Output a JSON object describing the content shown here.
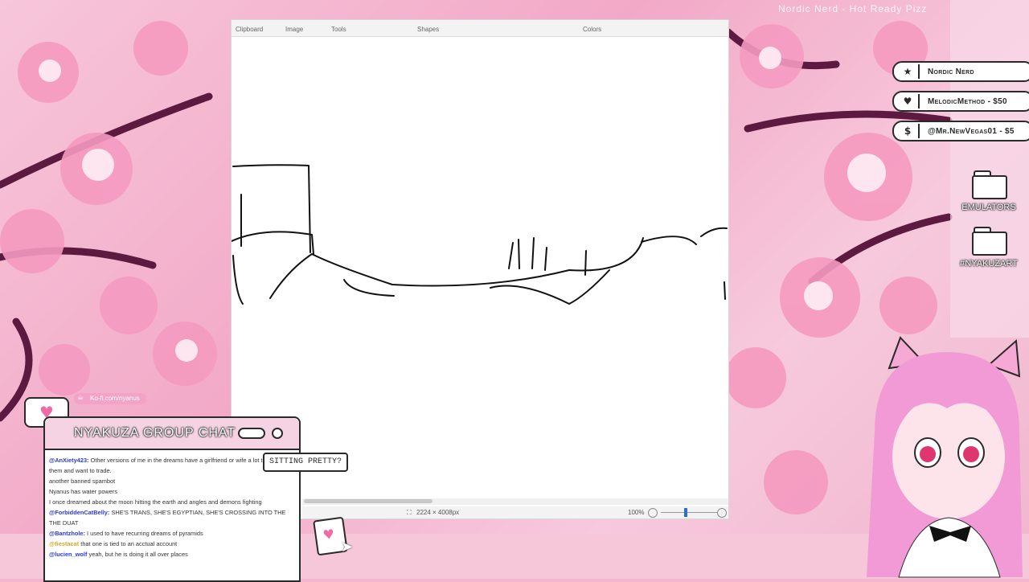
{
  "paint": {
    "ribbon": {
      "clipboard": "Clipboard",
      "image": "Image",
      "tools": "Tools",
      "shapes": "Shapes",
      "colors": "Colors"
    },
    "status": {
      "dimensions": "2224 × 4008px",
      "zoom": "100%"
    }
  },
  "now_playing": "Nordic Nerd - Hot Ready Pizz",
  "alerts": [
    {
      "icon": "star-icon",
      "glyph": "★",
      "text": "Nordic Nerd"
    },
    {
      "icon": "heart-icon",
      "glyph": "♥",
      "text": "MelodicMethod - $50"
    },
    {
      "icon": "dollar-icon",
      "glyph": "$",
      "text": "@Mr.NewVegas01 - $5"
    }
  ],
  "folders": [
    {
      "label": "EMULATORS"
    },
    {
      "label": "#NYAKUZART"
    }
  ],
  "kofi": "Ko-fi.com/nyanus",
  "chat": {
    "title": "NYAKUZA GROUP CHAT",
    "messages": [
      {
        "user": "@AnXiety423:",
        "user_color": "#2b3bd6",
        "text": "Other versions of me in the dreams have a girlfriend or wife a lot too. I hate them and want to trade."
      },
      {
        "user": "",
        "user_color": "#e08a3c",
        "text": "another banned spambot"
      },
      {
        "user": "",
        "user_color": "#e08a3c",
        "text": "Nyanus has water powers"
      },
      {
        "user": "",
        "user_color": "#3cc43c",
        "text": "I once dreamed about the moon hitting the earth and angles and demons fighting"
      },
      {
        "user": "@ForbiddenCatBelly:",
        "user_color": "#2b3bd6",
        "text": "SHE'S TRANS, SHE'S EGYPTIAN, SHE'S CROSSING INTO THE THE DUAT"
      },
      {
        "user": "@Bantzhole:",
        "user_color": "#2b3bd6",
        "text": "I used to have recurring dreams of pyramids"
      },
      {
        "user": "@fiestacat",
        "user_color": "#d4a72c",
        "text": "that one is tied to an acctual account"
      },
      {
        "user": "@lucien_wolf",
        "user_color": "#2b3bd6",
        "text": "yeah, but he is doing it all over places"
      }
    ]
  },
  "speech_bubble": "SITTING PRETTY?",
  "colors": {
    "accent_pink": "#f3a3c7",
    "outline": "#2a2a2a",
    "panel_pink": "#f6d3e2"
  }
}
